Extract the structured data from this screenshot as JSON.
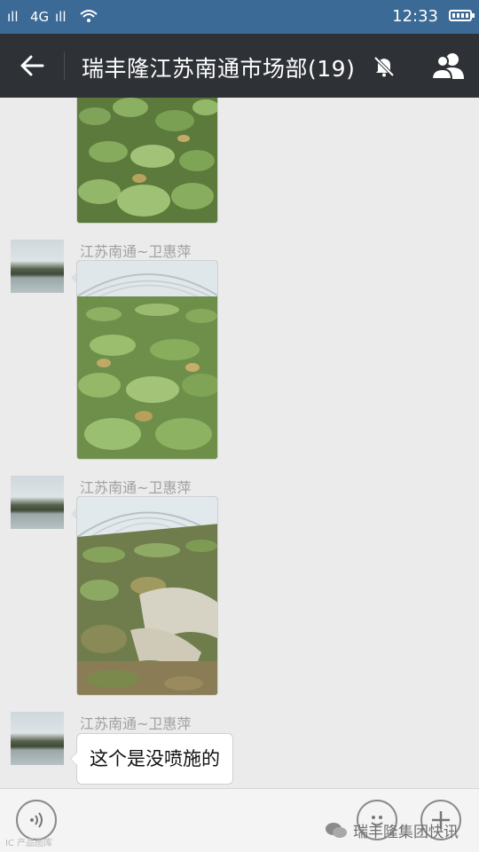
{
  "status_bar": {
    "signal_1": "ıll",
    "network": "4G",
    "signal_2": "ıll",
    "time": "12:33"
  },
  "header": {
    "title": "瑞丰隆江苏南通市场部(19)",
    "back_icon": "arrow-left-icon",
    "mute_icon": "bell-off-icon",
    "members_icon": "group-icon"
  },
  "messages": [
    {
      "type": "image",
      "sender": "",
      "image_desc": "pumpkin-field-photo"
    },
    {
      "type": "image",
      "sender": "江苏南通~卫惠萍",
      "image_desc": "greenhouse-pumpkin-photo"
    },
    {
      "type": "image",
      "sender": "江苏南通~卫惠萍",
      "image_desc": "greenhouse-damaged-crop-photo"
    },
    {
      "type": "text",
      "sender": "江苏南通~卫惠萍",
      "text": "这个是没喷施的"
    }
  ],
  "input_bar": {
    "voice_icon": "voice-icon",
    "emoji_icon": "emoji-icon",
    "more_icon": "plus-icon"
  },
  "watermark": {
    "left": "IC 产品图库",
    "right": "瑞丰隆集团快讯"
  },
  "colors": {
    "status_bar": "#3c6a96",
    "title_bar": "#2e3136",
    "chat_bg": "#ebebeb"
  }
}
